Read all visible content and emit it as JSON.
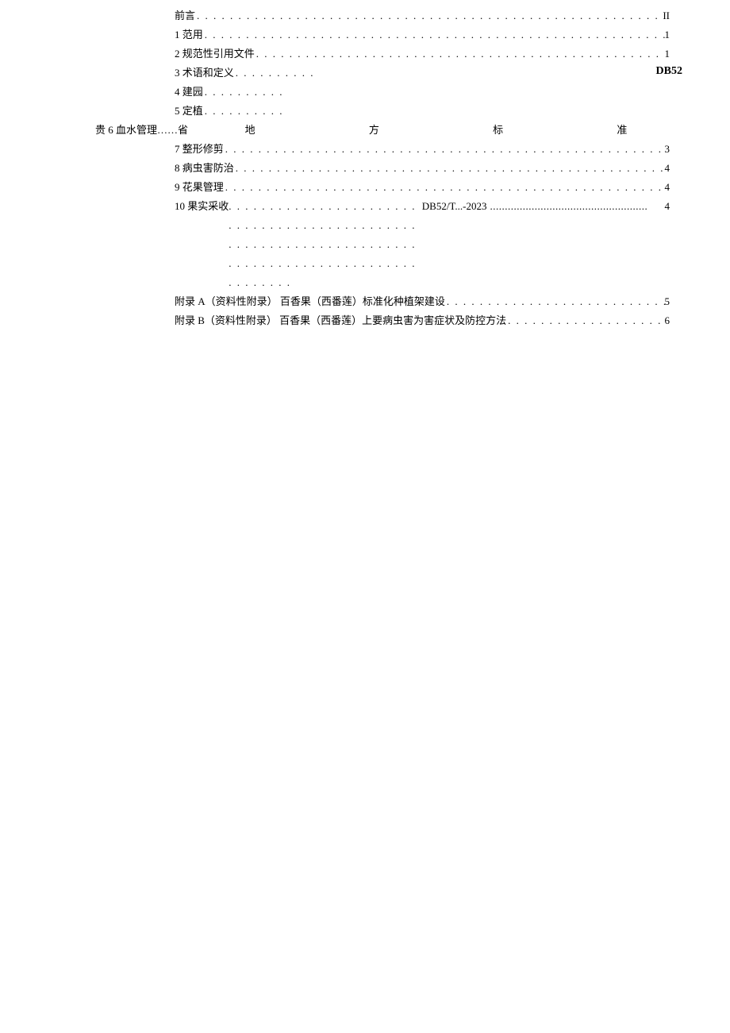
{
  "db_label": "DB52",
  "province_prefix": "贵 6 血水管理……省",
  "province_chars": [
    "地",
    "方",
    "标",
    "准"
  ],
  "toc": [
    {
      "label": "前言",
      "page": "II"
    },
    {
      "label": "1 范用",
      "page": "1"
    },
    {
      "label": "2 规范性引用文件",
      "page": "1"
    },
    {
      "label": "3 术语和定义",
      "page": ""
    },
    {
      "label": "4 建园",
      "page": ""
    },
    {
      "label": "5 定植",
      "page": ""
    },
    {
      "label": "7 整形修剪",
      "page": "3"
    },
    {
      "label": "8 病虫害防治",
      "page": "4"
    },
    {
      "label": "9 花果管理",
      "page": "4"
    }
  ],
  "line10": {
    "label": "10 果实采收",
    "mid": "DB52/T...-2023",
    "page": "4"
  },
  "appendices": [
    {
      "label": "附录 A（资料性附录）  百香果（西番莲）标准化种植架建设",
      "page": "5"
    },
    {
      "label": "附录 B（资料性附录）  百香果（西番莲）上要病虫害为害症状及防控方法",
      "page": "6"
    }
  ],
  "leaders": {
    "long": ". . . . . . . . . . . . . . . . . . . . . . . . . . . . . . . . . . . . . . . . . . . . . . . . . . . . . . . . . . . . . . . . . . . . . . . . . . . . . . . . . . . . . . . . . . . . . . . . . . . .",
    "short": ". . . . . . . . . .",
    "thin": "....................................................."
  }
}
